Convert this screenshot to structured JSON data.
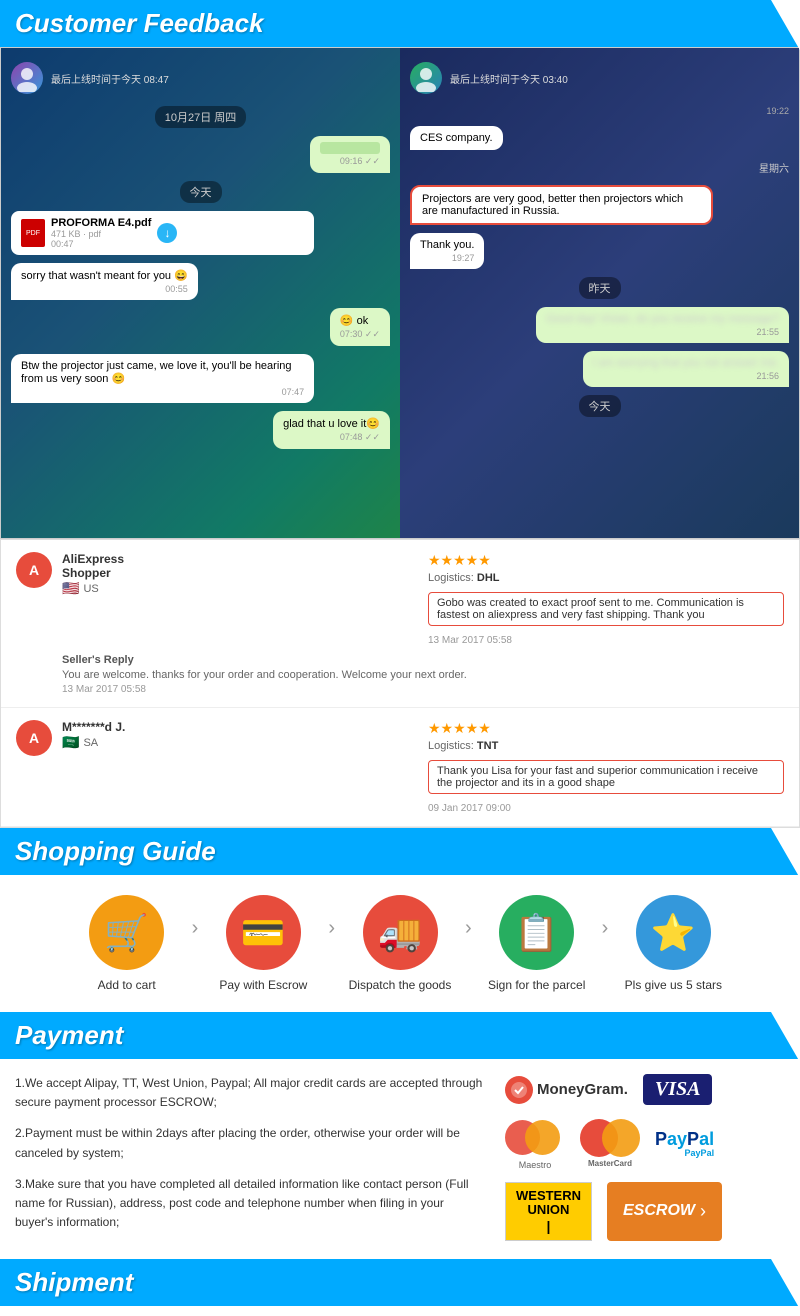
{
  "sections": {
    "customer_feedback": {
      "title": "Customer Feedback"
    },
    "shopping_guide": {
      "title": "Shopping Guide",
      "steps": [
        {
          "id": "add-to-cart",
          "label": "Add to cart",
          "icon": "🛒",
          "color": "#f39c12"
        },
        {
          "id": "pay-with-escrow",
          "label": "Pay with Escrow",
          "icon": "💳",
          "color": "#e74c3c"
        },
        {
          "id": "dispatch-goods",
          "label": "Dispatch the goods",
          "icon": "🚚",
          "color": "#e74c3c"
        },
        {
          "id": "sign-parcel",
          "label": "Sign for the parcel",
          "icon": "📋",
          "color": "#27ae60"
        },
        {
          "id": "give-stars",
          "label": "Pls give us 5 stars",
          "icon": "⭐",
          "color": "#3498db"
        }
      ]
    },
    "payment": {
      "title": "Payment",
      "text1": "1.We accept Alipay, TT, West Union, Paypal; All major credit cards are accepted through secure payment processor ESCROW;",
      "text2": "2.Payment must be within 2days after placing the order, otherwise your order will be canceled by system;",
      "text3": "3.Make sure that you have completed all detailed information like contact person (Full name for Russian), address, post code and telephone number when filing in your buyer's information;"
    },
    "shipment": {
      "title": "Shipment"
    },
    "chat_left": {
      "header": "最后上线时间于今天 08:47",
      "date1": "10月27日 周四",
      "time1": "09:16 ✓✓",
      "today": "今天",
      "filename": "PROFORMA E4.pdf",
      "filesize": "471 KB · pdf",
      "filetime": "00:47",
      "msg1": "sorry that wasn't meant for you 😄",
      "msg1time": "00:55",
      "ok_msg": "😊 ok",
      "ok_time": "07:30 ✓✓",
      "projector_msg": "Btw the projector just came, we love it, you'll be hearing from us very soon 😊",
      "projector_time": "07:47",
      "glad_msg": "glad that u love it😊",
      "glad_time": "07:48 ✓✓"
    },
    "chat_right": {
      "header": "最后上线时间于今天 03:40",
      "company": "CES company.",
      "time_stamp": "19:22",
      "day": "星期六",
      "review_msg": "Projectors are very good, better then projectors which are manufactured in Russia.",
      "thank_you": "Thank you.",
      "thank_time": "19:27",
      "yesterday": "昨天",
      "blurred1": "Good day! Vivian, do you receive my message?",
      "time_blurred1": "21:55",
      "blurred2": "I am worrying that you not answer me.",
      "time_blurred2": "21:56",
      "today": "今天"
    },
    "reviews": [
      {
        "id": "review-1",
        "avatar_letter": "A",
        "avatar_color": "#e74c3c",
        "shopper": "AliExpress\nShopper",
        "country": "US",
        "flag": "🇺🇸",
        "stars": "★★★★★",
        "logistics_label": "Logistics:",
        "logistics": "DHL",
        "text": "Gobo was created to exact proof sent to me. Communication is fastest on aliexpress and very fast shipping. Thank you",
        "date": "13 Mar 2017 05:58",
        "seller_reply_label": "Seller's Reply",
        "seller_reply_text": "You are welcome. thanks for your order and cooperation. Welcome your next order.",
        "seller_reply_date": "13 Mar 2017 05:58"
      },
      {
        "id": "review-2",
        "avatar_letter": "A",
        "avatar_color": "#e74c3c",
        "shopper": "M*******d J.",
        "country": "SA",
        "flag": "🇸🇦",
        "stars": "★★★★★",
        "logistics_label": "Logistics:",
        "logistics": "TNT",
        "text": "Thank you Lisa for your fast and superior communication i receive the projector and its in a good shape",
        "date": "09 Jan 2017 09:00"
      }
    ]
  }
}
